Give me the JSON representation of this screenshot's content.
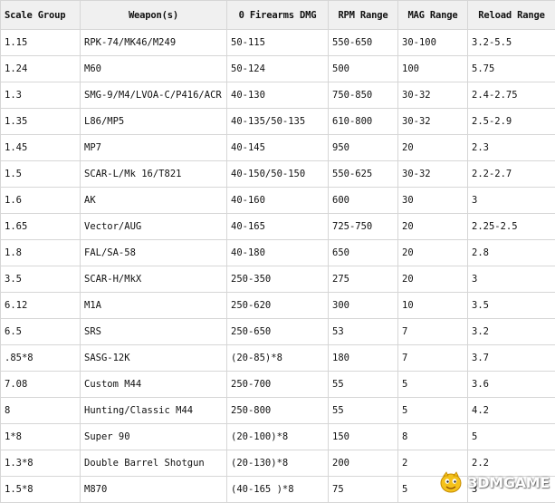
{
  "table": {
    "headers": [
      "Scale Group",
      "Weapon(s)",
      "0 Firearms DMG",
      "RPM Range",
      "MAG Range",
      "Reload Range"
    ],
    "rows": [
      [
        "1.15",
        "RPK-74/MK46/M249",
        "50-115",
        "550-650",
        "30-100",
        "3.2-5.5"
      ],
      [
        "1.24",
        "M60",
        "50-124",
        "500",
        "100",
        "5.75"
      ],
      [
        "1.3",
        "SMG-9/M4/LVOA-C/P416/ACR",
        "40-130",
        "750-850",
        "30-32",
        "2.4-2.75"
      ],
      [
        "1.35",
        "L86/MP5",
        "40-135/50-135",
        "610-800",
        "30-32",
        "2.5-2.9"
      ],
      [
        "1.45",
        "MP7",
        "40-145",
        "950",
        "20",
        "2.3"
      ],
      [
        "1.5",
        "SCAR-L/Mk 16/T821",
        "40-150/50-150",
        "550-625",
        "30-32",
        "2.2-2.7"
      ],
      [
        "1.6",
        "AK",
        "40-160",
        "600",
        "30",
        "3"
      ],
      [
        "1.65",
        "Vector/AUG",
        "40-165",
        "725-750",
        "20",
        "2.25-2.5"
      ],
      [
        "1.8",
        "FAL/SA-58",
        "40-180",
        "650",
        "20",
        "2.8"
      ],
      [
        "3.5",
        "SCAR-H/MkX",
        "250-350",
        "275",
        "20",
        "3"
      ],
      [
        "6.12",
        "M1A",
        "250-620",
        "300",
        "10",
        "3.5"
      ],
      [
        "6.5",
        "SRS",
        "250-650",
        "53",
        "7",
        "3.2"
      ],
      [
        ".85*8",
        "SASG-12K",
        "(20-85)*8",
        "180",
        "7",
        "3.7"
      ],
      [
        "7.08",
        "Custom M44",
        "250-700",
        "55",
        "5",
        "3.6"
      ],
      [
        "8",
        "Hunting/Classic M44",
        "250-800",
        "55",
        "5",
        "4.2"
      ],
      [
        "1*8",
        "Super 90",
        "(20-100)*8",
        "150",
        "8",
        "5"
      ],
      [
        "1.3*8",
        "Double Barrel Shotgun",
        "(20-130)*8",
        "200",
        "2",
        "2.2"
      ],
      [
        "1.5*8",
        "M870",
        "(40-165 )*8",
        "75",
        "5",
        "3"
      ]
    ]
  },
  "watermark": {
    "text": "3DMGAME"
  },
  "colors": {
    "header_bg": "#f0f0f0",
    "border": "#d6d6d6",
    "text": "#111111"
  }
}
